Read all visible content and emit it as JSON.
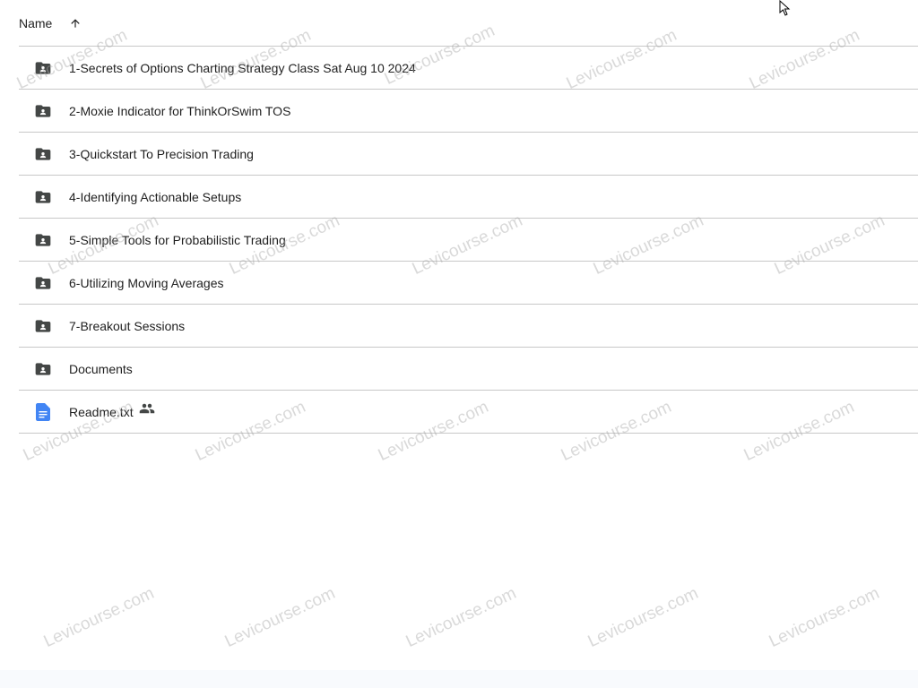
{
  "header": {
    "name_label": "Name",
    "sort_icon": "arrow-up-icon"
  },
  "rows": [
    {
      "name": "1-Secrets of Options Charting Strategy Class Sat Aug 10 2024",
      "type": "shared-folder"
    },
    {
      "name": "2-Moxie Indicator for ThinkOrSwim TOS",
      "type": "shared-folder"
    },
    {
      "name": "3-Quickstart To Precision Trading",
      "type": "shared-folder"
    },
    {
      "name": "4-Identifying Actionable Setups",
      "type": "shared-folder"
    },
    {
      "name": "5-Simple Tools for Probabilistic Trading",
      "type": "shared-folder"
    },
    {
      "name": "6-Utilizing Moving Averages",
      "type": "shared-folder"
    },
    {
      "name": "7-Breakout Sessions",
      "type": "shared-folder"
    },
    {
      "name": "Documents",
      "type": "shared-folder"
    },
    {
      "name": "Readme.txt",
      "type": "doc",
      "shared": true
    }
  ],
  "watermark": "Levicourse.com",
  "colors": {
    "folder": "#444746",
    "doc": "#4285f4",
    "divider": "#c7c7c7",
    "text": "#1f1f1f"
  }
}
